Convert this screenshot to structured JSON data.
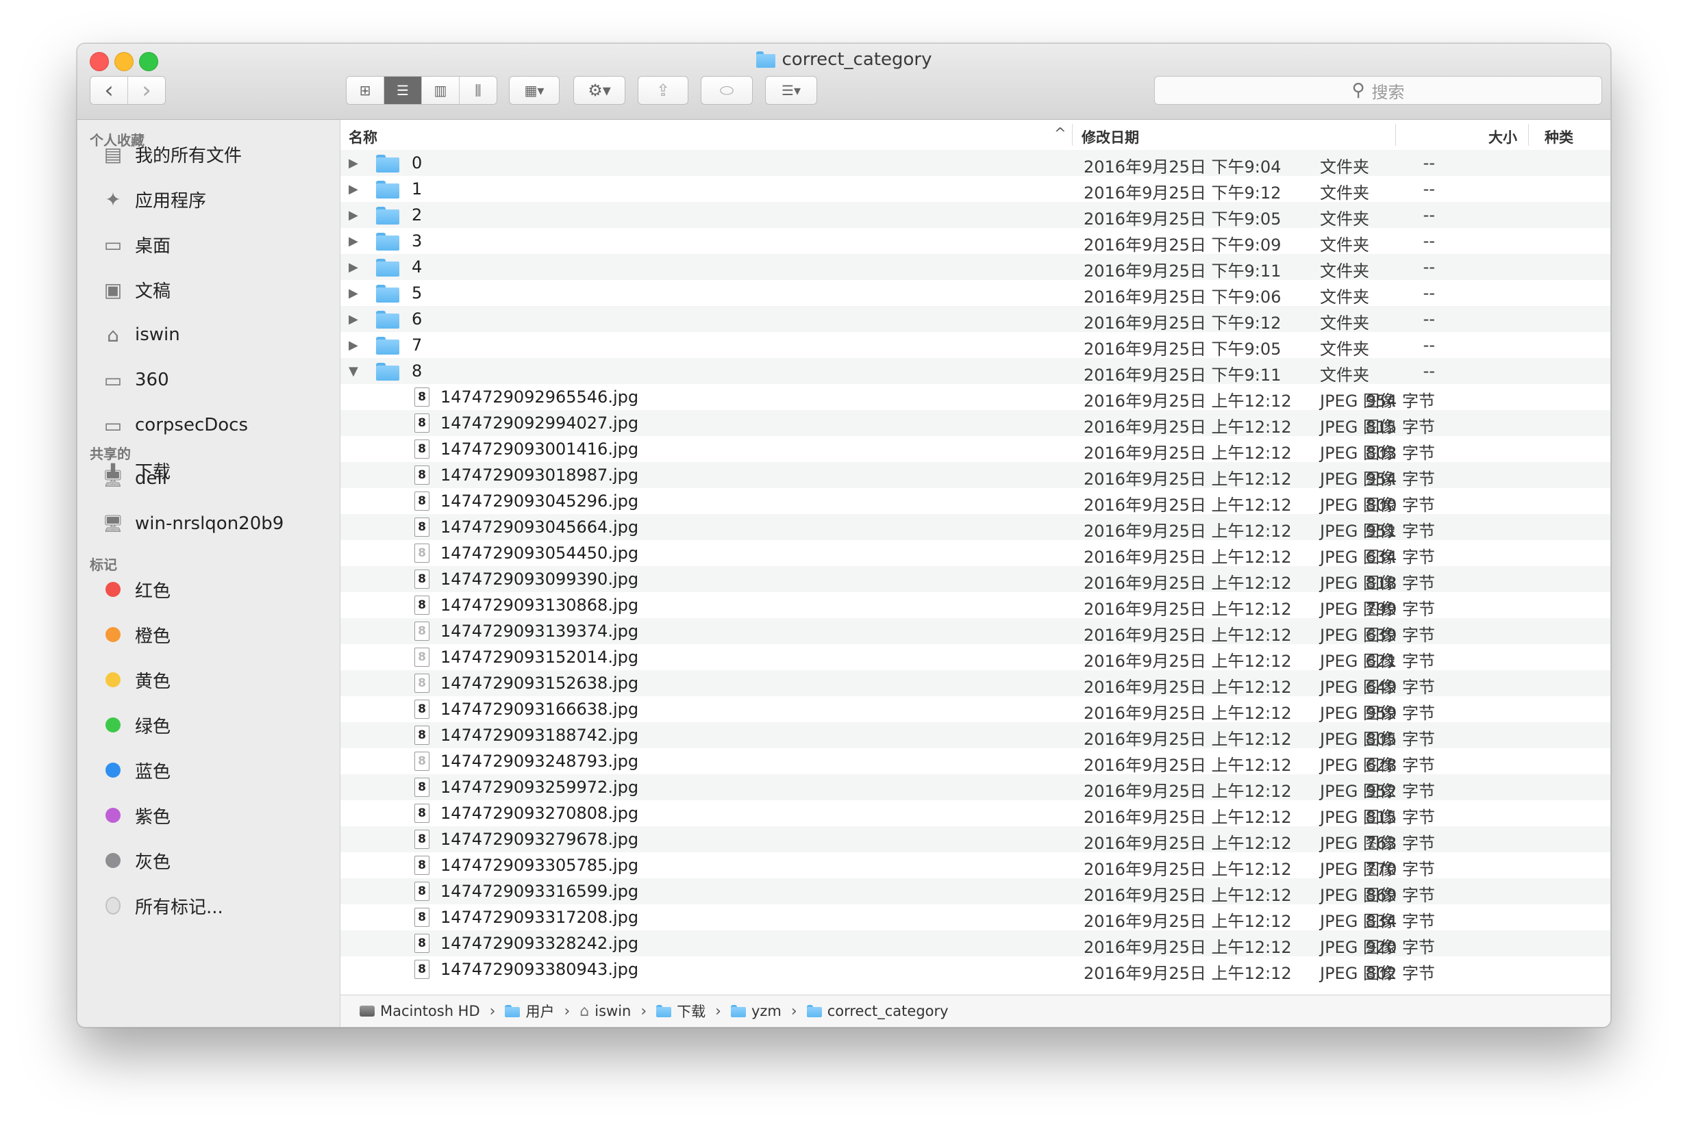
{
  "window": {
    "title": "correct_category"
  },
  "toolbar": {
    "back": "‹",
    "forward": "›",
    "search_placeholder": "搜索"
  },
  "sidebar": {
    "favorites_header": "个人收藏",
    "favorites": [
      {
        "label": "我的所有文件",
        "icon": "all-files-icon"
      },
      {
        "label": "应用程序",
        "icon": "applications-icon"
      },
      {
        "label": "桌面",
        "icon": "desktop-icon"
      },
      {
        "label": "文稿",
        "icon": "documents-icon"
      },
      {
        "label": "iswin",
        "icon": "home-icon"
      },
      {
        "label": "360",
        "icon": "folder-icon"
      },
      {
        "label": "corpsecDocs",
        "icon": "folder-icon"
      },
      {
        "label": "下载",
        "icon": "downloads-icon"
      }
    ],
    "shared_header": "共享的",
    "shared": [
      {
        "label": "dell",
        "icon": "computer-icon"
      },
      {
        "label": "win-nrslqon20b9",
        "icon": "computer-icon"
      }
    ],
    "tags_header": "标记",
    "tags": [
      {
        "label": "红色",
        "color": "#f2504b"
      },
      {
        "label": "橙色",
        "color": "#f79a36"
      },
      {
        "label": "黄色",
        "color": "#f8c73d"
      },
      {
        "label": "绿色",
        "color": "#3ec84a"
      },
      {
        "label": "蓝色",
        "color": "#2e8ff0"
      },
      {
        "label": "紫色",
        "color": "#bf5fd6"
      },
      {
        "label": "灰色",
        "color": "#8e8e93"
      },
      {
        "label": "所有标记...",
        "color": "#e0e0e0"
      }
    ]
  },
  "columns": {
    "name": "名称",
    "date": "修改日期",
    "size": "大小",
    "kind": "种类",
    "sort_indicator": "^"
  },
  "rows": [
    {
      "type": "folder",
      "name": "0",
      "date": "2016年9月25日 下午9:04",
      "size": "--",
      "kind": "文件夹",
      "expanded": false
    },
    {
      "type": "folder",
      "name": "1",
      "date": "2016年9月25日 下午9:12",
      "size": "--",
      "kind": "文件夹",
      "expanded": false
    },
    {
      "type": "folder",
      "name": "2",
      "date": "2016年9月25日 下午9:05",
      "size": "--",
      "kind": "文件夹",
      "expanded": false
    },
    {
      "type": "folder",
      "name": "3",
      "date": "2016年9月25日 下午9:09",
      "size": "--",
      "kind": "文件夹",
      "expanded": false
    },
    {
      "type": "folder",
      "name": "4",
      "date": "2016年9月25日 下午9:11",
      "size": "--",
      "kind": "文件夹",
      "expanded": false
    },
    {
      "type": "folder",
      "name": "5",
      "date": "2016年9月25日 下午9:06",
      "size": "--",
      "kind": "文件夹",
      "expanded": false
    },
    {
      "type": "folder",
      "name": "6",
      "date": "2016年9月25日 下午9:12",
      "size": "--",
      "kind": "文件夹",
      "expanded": false
    },
    {
      "type": "folder",
      "name": "7",
      "date": "2016年9月25日 下午9:05",
      "size": "--",
      "kind": "文件夹",
      "expanded": false
    },
    {
      "type": "folder",
      "name": "8",
      "date": "2016年9月25日 下午9:11",
      "size": "--",
      "kind": "文件夹",
      "expanded": true
    },
    {
      "type": "file",
      "name": "1474729092965546.jpg",
      "date": "2016年9月25日 上午12:12",
      "size": "954 字节",
      "kind": "JPEG 图像",
      "glyph": "8"
    },
    {
      "type": "file",
      "name": "1474729092994027.jpg",
      "date": "2016年9月25日 上午12:12",
      "size": "815 字节",
      "kind": "JPEG 图像",
      "glyph": "8"
    },
    {
      "type": "file",
      "name": "1474729093001416.jpg",
      "date": "2016年9月25日 上午12:12",
      "size": "803 字节",
      "kind": "JPEG 图像",
      "glyph": "8"
    },
    {
      "type": "file",
      "name": "1474729093018987.jpg",
      "date": "2016年9月25日 上午12:12",
      "size": "954 字节",
      "kind": "JPEG 图像",
      "glyph": "8"
    },
    {
      "type": "file",
      "name": "1474729093045296.jpg",
      "date": "2016年9月25日 上午12:12",
      "size": "800 字节",
      "kind": "JPEG 图像",
      "glyph": "8"
    },
    {
      "type": "file",
      "name": "1474729093045664.jpg",
      "date": "2016年9月25日 上午12:12",
      "size": "951 字节",
      "kind": "JPEG 图像",
      "glyph": "8"
    },
    {
      "type": "file",
      "name": "1474729093054450.jpg",
      "date": "2016年9月25日 上午12:12",
      "size": "634 字节",
      "kind": "JPEG 图像",
      "glyph": "8",
      "light": true
    },
    {
      "type": "file",
      "name": "1474729093099390.jpg",
      "date": "2016年9月25日 上午12:12",
      "size": "818 字节",
      "kind": "JPEG 图像",
      "glyph": "8"
    },
    {
      "type": "file",
      "name": "1474729093130868.jpg",
      "date": "2016年9月25日 上午12:12",
      "size": "799 字节",
      "kind": "JPEG 图像",
      "glyph": "8"
    },
    {
      "type": "file",
      "name": "1474729093139374.jpg",
      "date": "2016年9月25日 上午12:12",
      "size": "639 字节",
      "kind": "JPEG 图像",
      "glyph": "8",
      "light": true
    },
    {
      "type": "file",
      "name": "1474729093152014.jpg",
      "date": "2016年9月25日 上午12:12",
      "size": "621 字节",
      "kind": "JPEG 图像",
      "glyph": "8",
      "light": true
    },
    {
      "type": "file",
      "name": "1474729093152638.jpg",
      "date": "2016年9月25日 上午12:12",
      "size": "649 字节",
      "kind": "JPEG 图像",
      "glyph": "8",
      "light": true
    },
    {
      "type": "file",
      "name": "1474729093166638.jpg",
      "date": "2016年9月25日 上午12:12",
      "size": "959 字节",
      "kind": "JPEG 图像",
      "glyph": "8"
    },
    {
      "type": "file",
      "name": "1474729093188742.jpg",
      "date": "2016年9月25日 上午12:12",
      "size": "805 字节",
      "kind": "JPEG 图像",
      "glyph": "8"
    },
    {
      "type": "file",
      "name": "1474729093248793.jpg",
      "date": "2016年9月25日 上午12:12",
      "size": "628 字节",
      "kind": "JPEG 图像",
      "glyph": "8",
      "light": true
    },
    {
      "type": "file",
      "name": "1474729093259972.jpg",
      "date": "2016年9月25日 上午12:12",
      "size": "952 字节",
      "kind": "JPEG 图像",
      "glyph": "8"
    },
    {
      "type": "file",
      "name": "1474729093270808.jpg",
      "date": "2016年9月25日 上午12:12",
      "size": "815 字节",
      "kind": "JPEG 图像",
      "glyph": "8"
    },
    {
      "type": "file",
      "name": "1474729093279678.jpg",
      "date": "2016年9月25日 上午12:12",
      "size": "763 字节",
      "kind": "JPEG 图像",
      "glyph": "8"
    },
    {
      "type": "file",
      "name": "1474729093305785.jpg",
      "date": "2016年9月25日 上午12:12",
      "size": "770 字节",
      "kind": "JPEG 图像",
      "glyph": "8"
    },
    {
      "type": "file",
      "name": "1474729093316599.jpg",
      "date": "2016年9月25日 上午12:12",
      "size": "869 字节",
      "kind": "JPEG 图像",
      "glyph": "8"
    },
    {
      "type": "file",
      "name": "1474729093317208.jpg",
      "date": "2016年9月25日 上午12:12",
      "size": "834 字节",
      "kind": "JPEG 图像",
      "glyph": "8"
    },
    {
      "type": "file",
      "name": "1474729093328242.jpg",
      "date": "2016年9月25日 上午12:12",
      "size": "920 字节",
      "kind": "JPEG 图像",
      "glyph": "8"
    },
    {
      "type": "file",
      "name": "1474729093380943.jpg",
      "date": "2016年9月25日 上午12:12",
      "size": "802 字节",
      "kind": "JPEG 图像",
      "glyph": "8"
    }
  ],
  "pathbar": [
    {
      "label": "Macintosh HD",
      "icon": "hard-drive-icon"
    },
    {
      "label": "用户",
      "icon": "folder-icon"
    },
    {
      "label": "iswin",
      "icon": "home-icon"
    },
    {
      "label": "下载",
      "icon": "folder-icon"
    },
    {
      "label": "yzm",
      "icon": "folder-icon"
    },
    {
      "label": "correct_category",
      "icon": "folder-icon"
    }
  ]
}
